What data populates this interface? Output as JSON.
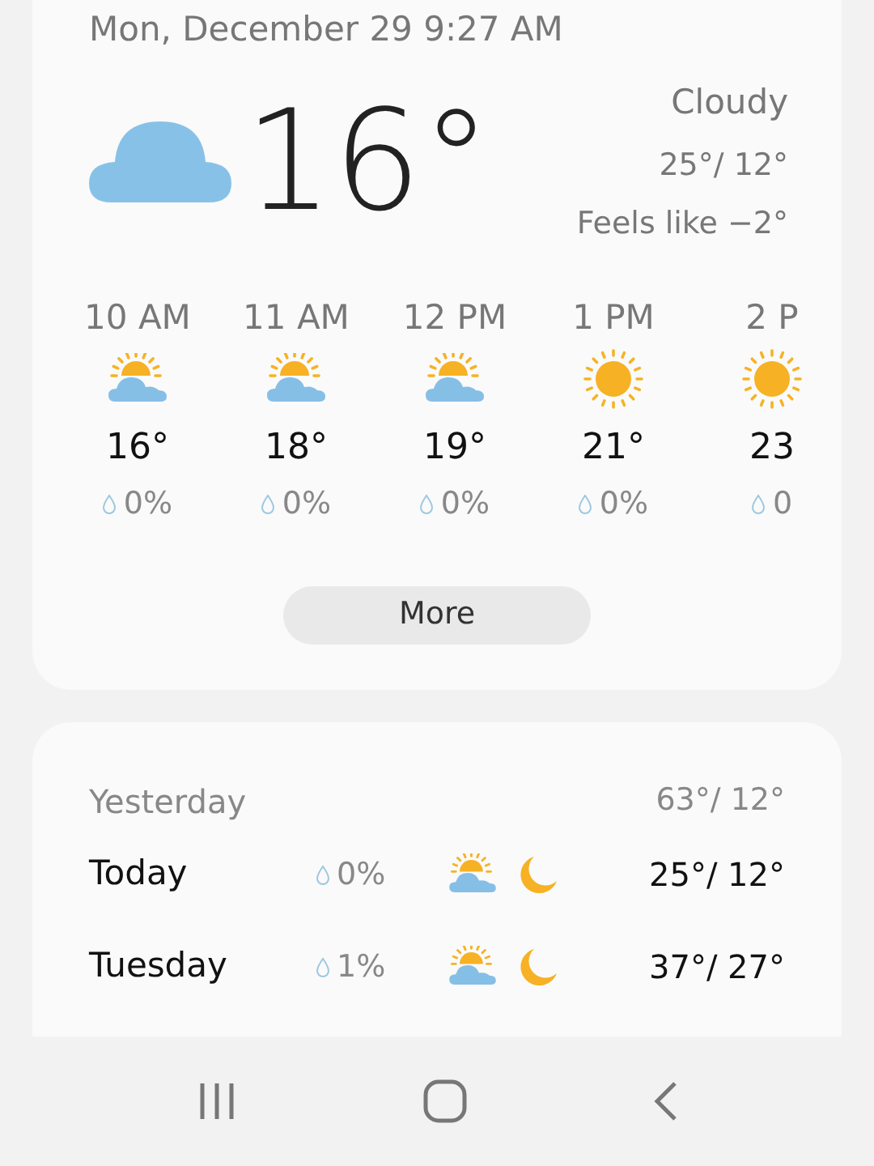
{
  "current": {
    "datetime": "Mon, December 29 9:27 AM",
    "icon": {
      "kind": "cloudy"
    },
    "temperature": "16°",
    "condition": "Cloudy",
    "high_low": "25°/ 12°",
    "feels_like": "Feels like −2°"
  },
  "hourly": [
    {
      "time": "10 AM",
      "kind": "partly_cloudy",
      "temperature": "16°",
      "precipitation": "0%"
    },
    {
      "time": "11 AM",
      "kind": "partly_cloudy",
      "temperature": "18°",
      "precipitation": "0%"
    },
    {
      "time": "12 PM",
      "kind": "partly_cloudy",
      "temperature": "19°",
      "precipitation": "0%"
    },
    {
      "time": "1 PM",
      "kind": "sunny",
      "temperature": "21°",
      "precipitation": "0%"
    },
    {
      "time": "2 P",
      "kind": "sunny",
      "temperature": "23",
      "precipitation": "0"
    }
  ],
  "more_button": "More",
  "yesterday": {
    "label": "Yesterday",
    "high_low": "63°/ 12°"
  },
  "daily": [
    {
      "day": "Today",
      "precipitation": "0%",
      "day_icon": {
        "kind": "partly_cloudy"
      },
      "night_icon": {
        "kind": "moon"
      },
      "high_low": "25°/ 12°"
    },
    {
      "day": "Tuesday",
      "precipitation": "1%",
      "day_icon": {
        "kind": "partly_cloudy"
      },
      "night_icon": {
        "kind": "moon"
      },
      "high_low": "37°/ 27°"
    }
  ]
}
